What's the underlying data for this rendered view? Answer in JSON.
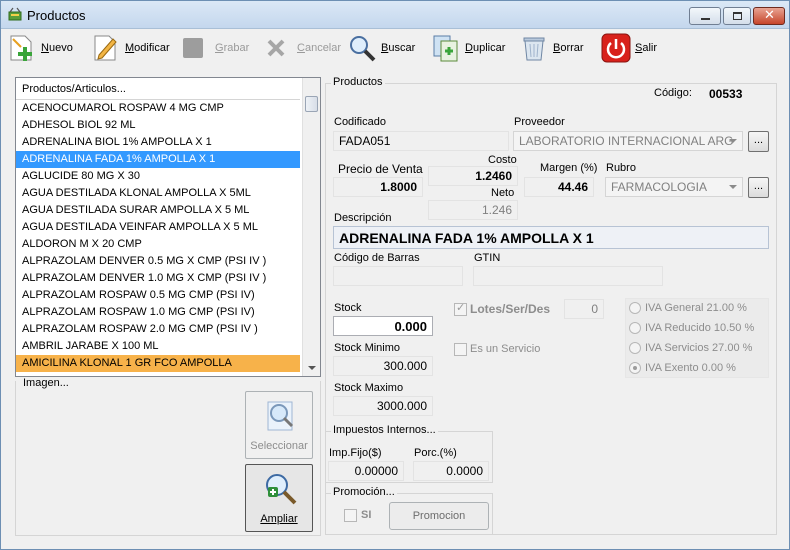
{
  "window": {
    "title": "Productos"
  },
  "toolbar": {
    "nuevo": "Nuevo",
    "modificar": "Modificar",
    "grabar": "Grabar",
    "cancelar": "Cancelar",
    "buscar": "Buscar",
    "duplicar": "Duplicar",
    "borrar": "Borrar",
    "salir": "Salir"
  },
  "list": {
    "header": "Productos/Articulos...",
    "items": [
      "ACENOCUMAROL ROSPAW 4 MG CMP",
      "ADHESOL BIOL 92 ML",
      "ADRENALINA BIOL 1% AMPOLLA X 1",
      "ADRENALINA FADA 1% AMPOLLA X 1",
      "AGLUCIDE 80 MG X 30",
      "AGUA DESTILADA KLONAL AMPOLLA X 5ML",
      "AGUA DESTILADA SURAR AMPOLLA X 5 ML",
      "AGUA DESTILADA VEINFAR AMPOLLA X 5 ML",
      "ALDORON M X 20 CMP",
      "ALPRAZOLAM DENVER 0.5 MG X CMP (PSI IV )",
      "ALPRAZOLAM DENVER 1.0 MG X CMP (PSI IV )",
      "ALPRAZOLAM ROSPAW 0.5 MG CMP (PSI IV)",
      "ALPRAZOLAM ROSPAW 1.0 MG CMP (PSI IV)",
      "ALPRAZOLAM ROSPAW 2.0 MG CMP (PSI IV )",
      "AMBRIL JARABE X 100 ML",
      "AMICILINA KLONAL 1 GR FCO AMPOLLA"
    ]
  },
  "imagen": {
    "label": "Imagen...",
    "seleccionar": "Seleccionar",
    "ampliar": "Ampliar"
  },
  "productos": {
    "group_label": "Productos",
    "codigo_label": "Código:",
    "codigo_value": "00533",
    "codificado_label": "Codificado",
    "codificado_value": "FADA051",
    "proveedor_label": "Proveedor",
    "proveedor_value": "LABORATORIO INTERNACIONAL ARG",
    "proveedor_btn": "...",
    "precio_label": "Precio de Venta",
    "precio_value": "1.8000",
    "costo_label": "Costo",
    "costo_value": "1.2460",
    "neto_label": "Neto",
    "neto_value": "1.246",
    "margen_label": "Margen (%)",
    "margen_value": "44.46",
    "rubro_label": "Rubro",
    "rubro_value": "FARMACOLOGIA",
    "rubro_btn": "...",
    "descripcion_label": "Descripción",
    "descripcion_value": "ADRENALINA FADA 1% AMPOLLA X 1",
    "barras_label": "Código de Barras",
    "barras_value": "",
    "gtin_label": "GTIN",
    "gtin_value": "",
    "stock_label": "Stock",
    "stock_value": "0.000",
    "stock_min_label": "Stock Minimo",
    "stock_min_value": "300.000",
    "stock_max_label": "Stock Maximo",
    "stock_max_value": "3000.000",
    "lotes_label": "Lotes/Ser/Des",
    "lotes_value": "0",
    "servicio_label": "Es un Servicio",
    "iva": [
      "IVA General 21.00 %",
      "IVA Reducido 10.50 %",
      "IVA Servicios 27.00 %",
      "IVA Exento 0.00 %"
    ]
  },
  "impuestos": {
    "label": "Impuestos Internos...",
    "impfijo_label": "Imp.Fijo($)",
    "impfijo_value": "0.00000",
    "porc_label": "Porc.(%)",
    "porc_value": "0.0000"
  },
  "promocion": {
    "label": "Promoción...",
    "si_label": "SI",
    "btn_label": "Promocion"
  }
}
